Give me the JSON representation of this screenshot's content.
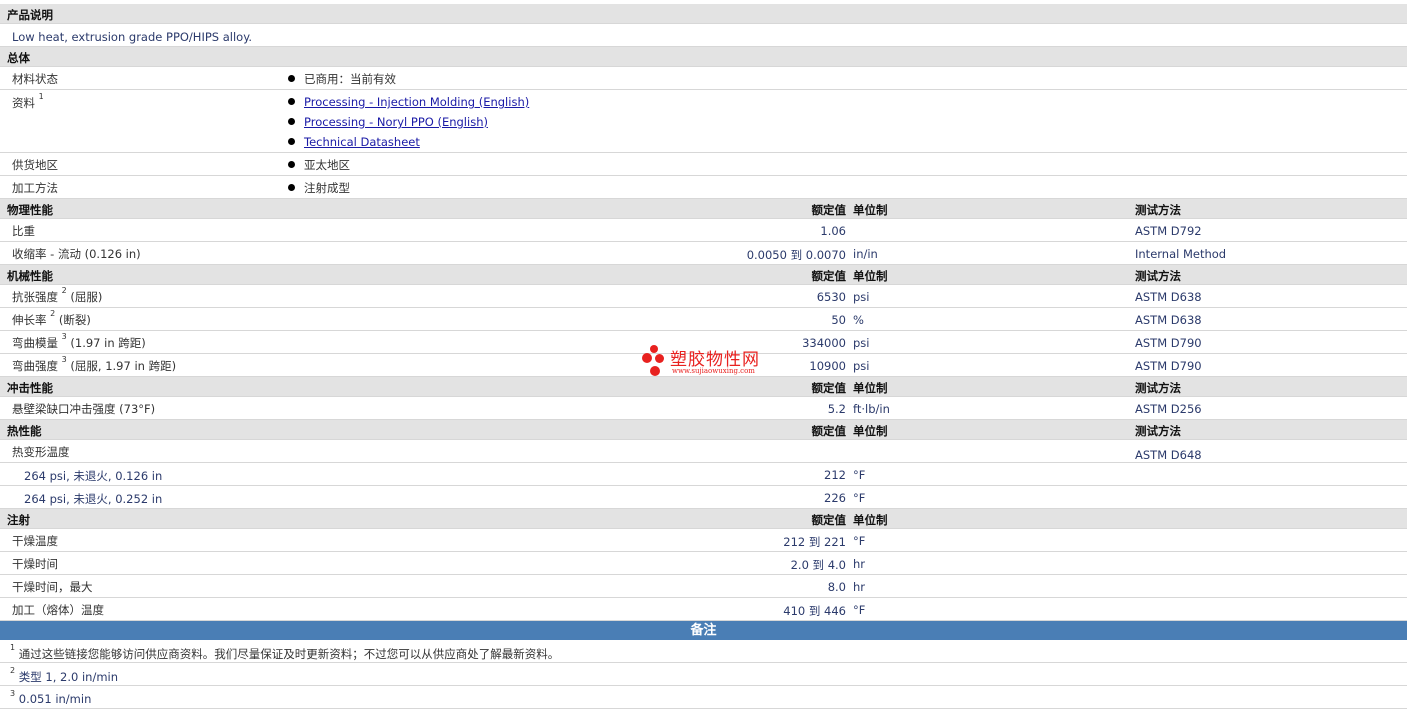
{
  "desc": {
    "title": "产品说明",
    "text": "Low heat, extrusion grade PPO/HIPS alloy."
  },
  "general": {
    "title": "总体",
    "status_label": "材料状态",
    "status_value": "已商用：当前有效",
    "docs_label": "资料",
    "docs_sup": "1",
    "docs": [
      "Processing - Injection Molding (English)",
      "Processing - Noryl PPO (English)",
      "Technical Datasheet"
    ],
    "region_label": "供货地区",
    "region_value": "亚太地区",
    "method_label": "加工方法",
    "method_value": "注射成型"
  },
  "headers": {
    "nominal": "额定值",
    "unit": "单位制",
    "test": "测试方法"
  },
  "physical": {
    "title": "物理性能",
    "rows": [
      {
        "label": "比重",
        "value": "1.06",
        "unit": "",
        "method": "ASTM D792"
      },
      {
        "label": "收缩率  - 流动  (0.126 in)",
        "value": "0.0050 到  0.0070",
        "unit": "in/in",
        "method": "Internal Method"
      }
    ]
  },
  "mechanical": {
    "title": "机械性能",
    "rows": [
      {
        "label": "抗张强度",
        "sup": "2",
        "suffix": " (屈服)",
        "value": "6530",
        "unit": "psi",
        "method": "ASTM D638"
      },
      {
        "label": "伸长率",
        "sup": "2",
        "suffix": " (断裂)",
        "value": "50",
        "unit": "%",
        "method": "ASTM D638"
      },
      {
        "label": "弯曲模量",
        "sup": "3",
        "suffix": " (1.97 in 跨距)",
        "value": "334000",
        "unit": "psi",
        "method": "ASTM D790"
      },
      {
        "label": "弯曲强度",
        "sup": "3",
        "suffix": " (屈服, 1.97 in 跨距)",
        "value": "10900",
        "unit": "psi",
        "method": "ASTM D790"
      }
    ]
  },
  "impact": {
    "title": "冲击性能",
    "rows": [
      {
        "label": "悬壁梁缺口冲击强度  (73°F)",
        "value": "5.2",
        "unit": "ft·lb/in",
        "method": "ASTM D256"
      }
    ]
  },
  "thermal": {
    "title": "热性能",
    "head_label": "热变形温度",
    "head_method": "ASTM D648",
    "rows": [
      {
        "label": "264 psi, 未退火, 0.126 in",
        "value": "212",
        "unit": "°F"
      },
      {
        "label": "264 psi, 未退火, 0.252 in",
        "value": "226",
        "unit": "°F"
      }
    ]
  },
  "injection": {
    "title": "注射",
    "rows": [
      {
        "label": "干燥温度",
        "value": "212 到  221",
        "unit": "°F"
      },
      {
        "label": "干燥时间",
        "value": "2.0 到  4.0",
        "unit": "hr"
      },
      {
        "label": "干燥时间，最大",
        "value": "8.0",
        "unit": "hr"
      },
      {
        "label": "加工（熔体）温度",
        "value": "410 到  446",
        "unit": "°F"
      }
    ]
  },
  "notes": {
    "title": "备注",
    "items": [
      {
        "sup": "1",
        "text": "通过这些链接您能够访问供应商资料。我们尽量保证及时更新资料；不过您可以从供应商处了解最新资料。"
      },
      {
        "sup": "2",
        "text": "类型  1, 2.0 in/min"
      },
      {
        "sup": "3",
        "text": "0.051 in/min"
      }
    ]
  },
  "watermark": {
    "name": "塑胶物性网",
    "url": "www.sujiaowuxing.com",
    "color": "#e8211f"
  },
  "colors": {
    "section_bg": "#e3e3e3",
    "notes_bg": "#4a7eb5",
    "link": "#1a1aa6"
  }
}
